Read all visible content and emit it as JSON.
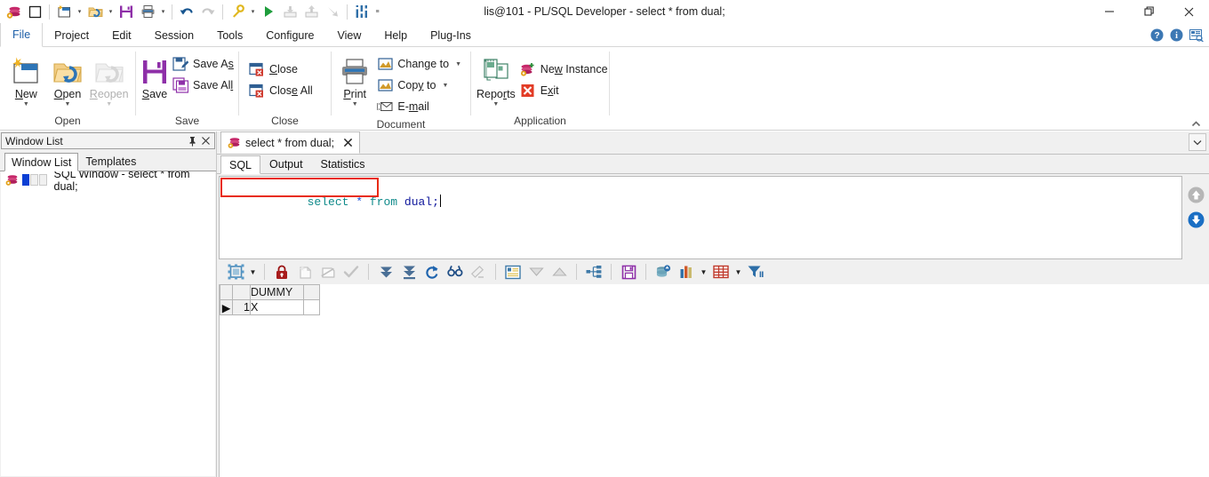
{
  "window": {
    "title": "lis@101 - PL/SQL Developer - select * from dual;",
    "minimize_label": "—",
    "restore_label": "❐",
    "close_label": "✕"
  },
  "quick_access": [
    {
      "name": "app-logo-icon",
      "label": "PL/SQL Developer"
    },
    {
      "name": "window-icon",
      "label": "Window"
    },
    {
      "name": "new-icon",
      "label": "New"
    },
    {
      "name": "open-icon",
      "label": "Open"
    },
    {
      "name": "save-icon",
      "label": "Save"
    },
    {
      "name": "print-icon",
      "label": "Print"
    },
    {
      "name": "undo-icon",
      "label": "Undo"
    },
    {
      "name": "redo-icon",
      "label": "Redo"
    },
    {
      "name": "explain-plan-icon",
      "label": "Explain Plan"
    },
    {
      "name": "execute-icon",
      "label": "Execute"
    },
    {
      "name": "commit-icon",
      "label": "Commit"
    },
    {
      "name": "rollback-icon",
      "label": "Rollback"
    },
    {
      "name": "break-icon",
      "label": "Break"
    },
    {
      "name": "preferences-icon",
      "label": "Preferences"
    },
    {
      "name": "customize-qat-icon",
      "label": "Customize Quick Access Toolbar"
    }
  ],
  "menu": {
    "items": [
      {
        "label": "File",
        "active": true
      },
      {
        "label": "Project",
        "active": false
      },
      {
        "label": "Edit",
        "active": false
      },
      {
        "label": "Session",
        "active": false
      },
      {
        "label": "Tools",
        "active": false
      },
      {
        "label": "Configure",
        "active": false
      },
      {
        "label": "View",
        "active": false
      },
      {
        "label": "Help",
        "active": false
      },
      {
        "label": "Plug-Ins",
        "active": false
      }
    ],
    "right_icons": [
      {
        "name": "help-icon",
        "label": "Help"
      },
      {
        "name": "info-icon",
        "label": "About"
      },
      {
        "name": "window-list-icon",
        "label": "Window List"
      }
    ]
  },
  "ribbon": {
    "collapse_label": "▲",
    "groups": [
      {
        "label": "Open",
        "big_buttons": [
          {
            "name": "new-button",
            "label": "New",
            "label_pre": "",
            "label_u": "N",
            "label_post": "ew",
            "has_arrow": true,
            "disabled": false
          },
          {
            "name": "open-button",
            "label": "Open",
            "label_pre": "",
            "label_u": "O",
            "label_post": "pen",
            "has_arrow": true,
            "disabled": false
          },
          {
            "name": "reopen-button",
            "label": "Reopen",
            "label_pre": "",
            "label_u": "R",
            "label_post": "eopen",
            "has_arrow": true,
            "disabled": true
          }
        ],
        "small_buttons": []
      },
      {
        "label": "Save",
        "big_buttons": [
          {
            "name": "save-button",
            "label": "Save",
            "label_pre": "",
            "label_u": "S",
            "label_post": "ave",
            "has_arrow": false,
            "disabled": false
          }
        ],
        "small_buttons": [
          {
            "name": "save-as-button",
            "label": "Save As",
            "pre": "Save A",
            "u": "s",
            "post": "",
            "has_arrow": false
          },
          {
            "name": "save-all-button",
            "label": "Save All",
            "pre": "Save Al",
            "u": "l",
            "post": "",
            "has_arrow": false
          }
        ]
      },
      {
        "label": "Close",
        "big_buttons": [],
        "small_buttons": [
          {
            "name": "close-button",
            "label": "Close",
            "pre": "",
            "u": "C",
            "post": "lose",
            "has_arrow": false
          },
          {
            "name": "close-all-button",
            "label": "Close All",
            "pre": "Clos",
            "u": "e",
            "post": " All",
            "has_arrow": false
          }
        ]
      },
      {
        "label": "Document",
        "big_buttons": [
          {
            "name": "print-button",
            "label": "Print",
            "label_pre": "",
            "label_u": "P",
            "label_post": "rint",
            "has_arrow": true,
            "disabled": false
          }
        ],
        "small_buttons": [
          {
            "name": "change-to-button",
            "label": "Change to",
            "pre": "Chan",
            "u": "g",
            "post": "e to",
            "has_arrow": true
          },
          {
            "name": "copy-to-button",
            "label": "Copy to",
            "pre": "Cop",
            "u": "y",
            "post": " to",
            "has_arrow": true
          },
          {
            "name": "email-button",
            "label": "E-mail",
            "pre": "E-",
            "u": "m",
            "post": "ail",
            "has_arrow": false
          }
        ]
      },
      {
        "label": "Application",
        "big_buttons": [
          {
            "name": "reports-button",
            "label": "Reports",
            "label_pre": "Repo",
            "label_u": "r",
            "label_post": "ts",
            "has_arrow": true,
            "disabled": false
          }
        ],
        "small_buttons": [
          {
            "name": "new-instance-button",
            "label": "New Instance",
            "pre": "Ne",
            "u": "w",
            "post": " Instance",
            "has_arrow": false
          },
          {
            "name": "exit-button",
            "label": "Exit",
            "pre": "E",
            "u": "x",
            "post": "it",
            "has_arrow": false
          }
        ]
      }
    ]
  },
  "dock_panel": {
    "title": "Window List",
    "pin_label": "⚐",
    "close_label": "✕",
    "tabs": [
      {
        "label": "Window List",
        "active": true
      },
      {
        "label": "Templates",
        "active": false
      }
    ],
    "tree_items": [
      {
        "label": "SQL Window - select * from dual;"
      }
    ]
  },
  "document": {
    "tab_label": "select * from dual;",
    "tab_close_label": "✕",
    "tab_scroll_label": "∨",
    "sub_tabs": [
      {
        "label": "SQL",
        "active": true
      },
      {
        "label": "Output",
        "active": false
      },
      {
        "label": "Statistics",
        "active": false
      }
    ]
  },
  "editor": {
    "tokens": [
      {
        "text": "select",
        "kind": "kw"
      },
      {
        "text": " ",
        "kind": "ws"
      },
      {
        "text": "*",
        "kind": "op"
      },
      {
        "text": " ",
        "kind": "ws"
      },
      {
        "text": "from",
        "kind": "kw"
      },
      {
        "text": " ",
        "kind": "ws"
      },
      {
        "text": "dual",
        "kind": "id"
      },
      {
        "text": ";",
        "kind": "pn"
      }
    ],
    "full_text": "select * from dual;",
    "highlight_color": "#e82c14"
  },
  "editor_nav": [
    {
      "name": "scroll-up-button",
      "label": "Previous",
      "enabled": false
    },
    {
      "name": "scroll-down-button",
      "label": "Next",
      "enabled": true
    }
  ],
  "result_toolbar": [
    {
      "name": "grid-layout-icon",
      "label": "Grid Layout",
      "type": "icon",
      "dropdown": true
    },
    {
      "name": "separator",
      "type": "sep"
    },
    {
      "name": "lock-icon",
      "label": "Lock",
      "type": "icon",
      "dropdown": false
    },
    {
      "name": "insert-record-icon",
      "label": "Insert Record",
      "type": "icon",
      "dropdown": false
    },
    {
      "name": "delete-record-icon",
      "label": "Delete Record",
      "type": "icon",
      "dropdown": false
    },
    {
      "name": "post-changes-icon",
      "label": "Post Changes",
      "type": "icon",
      "dropdown": false
    },
    {
      "name": "separator",
      "type": "sep"
    },
    {
      "name": "fetch-next-page-icon",
      "label": "Fetch Next Page",
      "type": "icon",
      "dropdown": false
    },
    {
      "name": "fetch-last-page-icon",
      "label": "Fetch Last Page",
      "type": "icon",
      "dropdown": false
    },
    {
      "name": "refresh-icon",
      "label": "Refresh",
      "type": "icon",
      "dropdown": false
    },
    {
      "name": "find-icon",
      "label": "Find",
      "type": "icon",
      "dropdown": false
    },
    {
      "name": "clear-icon",
      "label": "Clear",
      "type": "icon",
      "dropdown": false
    },
    {
      "name": "separator",
      "type": "sep"
    },
    {
      "name": "single-record-view-icon",
      "label": "Single Record View",
      "type": "icon",
      "dropdown": false
    },
    {
      "name": "collapse-icon",
      "label": "Collapse",
      "type": "icon",
      "dropdown": false
    },
    {
      "name": "expand-icon",
      "label": "Expand",
      "type": "icon",
      "dropdown": false
    },
    {
      "name": "separator",
      "type": "sep"
    },
    {
      "name": "dependency-icon",
      "label": "Dependencies",
      "type": "icon",
      "dropdown": false
    },
    {
      "name": "separator",
      "type": "sep"
    },
    {
      "name": "export-save-icon",
      "label": "Export Data",
      "type": "icon",
      "dropdown": false
    },
    {
      "name": "separator",
      "type": "sep"
    },
    {
      "name": "query-data-icon",
      "label": "Query Data",
      "type": "icon",
      "dropdown": false
    },
    {
      "name": "chart-icon",
      "label": "Chart",
      "type": "icon",
      "dropdown": true
    },
    {
      "name": "table-view-icon",
      "label": "Table View",
      "type": "icon",
      "dropdown": true
    },
    {
      "name": "filter-icon",
      "label": "Filter",
      "type": "icon",
      "dropdown": false
    }
  ],
  "result_grid": {
    "columns": [
      "DUMMY"
    ],
    "rows": [
      {
        "indicator": "▶",
        "number": "1",
        "cells": [
          "X"
        ]
      }
    ]
  }
}
